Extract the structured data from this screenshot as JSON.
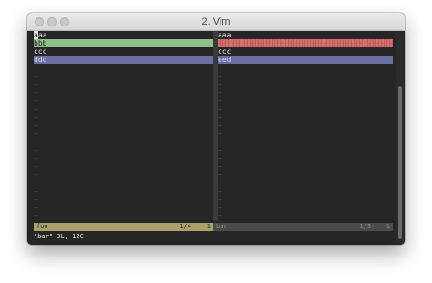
{
  "window": {
    "title": "2. Vim"
  },
  "left_pane": {
    "lines": [
      "aaa",
      "bbb",
      "ccc",
      "ddd"
    ],
    "status": {
      "filename": "foo",
      "position": "1/4",
      "column": "1"
    }
  },
  "right_pane": {
    "lines": [
      "aaa",
      "",
      "ccc",
      "eed"
    ],
    "status": {
      "filename": "bar",
      "position": "1/3",
      "column": "1"
    }
  },
  "filler_glyph": "~",
  "command_line": "\"bar\" 3L, 12C",
  "colors": {
    "added": "#8fbf8a",
    "deleted": "#d56f6f",
    "changed": "#6c6fa3",
    "status_active": "#aaa26c",
    "status_inactive": "#4b4b4b",
    "background": "#262626"
  }
}
